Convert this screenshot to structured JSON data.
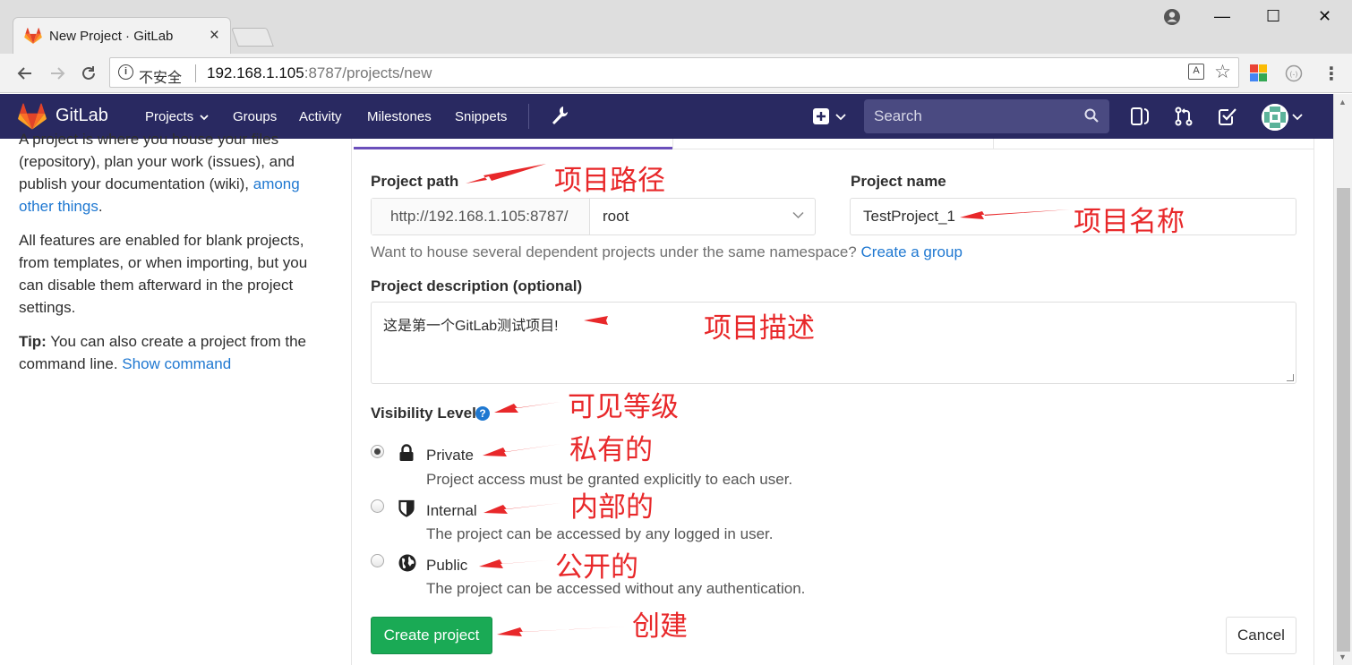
{
  "browser": {
    "tab_title": "New Project · GitLab",
    "tab_close": "×",
    "insecure_label": "不安全",
    "url_host": "192.168.1.105",
    "url_rest": ":8787/projects/new",
    "window_min": "—",
    "window_max": "☐",
    "window_close": "✕"
  },
  "header": {
    "brand": "GitLab",
    "nav": [
      "Projects",
      "Groups",
      "Activity",
      "Milestones",
      "Snippets"
    ],
    "search_placeholder": "Search",
    "colors": {
      "header_bg": "#292961",
      "search_bg": "#4a4a81",
      "accent": "#6b4fbb"
    }
  },
  "sidebar": {
    "intro_text": "A project is where you house your files (repository), plan your work (issues), and publish your documentation (wiki), ",
    "intro_link": "among other things",
    "intro_end": ".",
    "features_text": "All features are enabled for blank projects, from templates, or when importing, but you can disable them afterward in the project settings.",
    "tip_label": "Tip:",
    "tip_text": " You can also create a project from the command line. ",
    "tip_link": "Show command"
  },
  "form": {
    "path_label": "Project path",
    "path_prefix": "http://192.168.1.105:8787/",
    "namespace": "root",
    "name_label": "Project name",
    "name_value": "TestProject_1",
    "ns_help_text": "Want to house several dependent projects under the same namespace? ",
    "ns_help_link": "Create a group",
    "desc_label": "Project description (optional)",
    "desc_value": "这是第一个GitLab测试项目!",
    "visibility_label": "Visibility Level",
    "help_icon": "?",
    "visibility_options": [
      {
        "label": "Private",
        "desc": "Project access must be granted explicitly to each user.",
        "checked": true,
        "icon": "lock-icon"
      },
      {
        "label": "Internal",
        "desc": "The project can be accessed by any logged in user.",
        "checked": false,
        "icon": "shield-icon"
      },
      {
        "label": "Public",
        "desc": "The project can be accessed without any authentication.",
        "checked": false,
        "icon": "globe-icon"
      }
    ],
    "create_button": "Create project",
    "cancel_button": "Cancel",
    "colors": {
      "create_bg": "#1aaa55",
      "link": "#1f78d1"
    }
  },
  "annotations": {
    "path": "项目路径",
    "name": "项目名称",
    "desc": "项目描述",
    "visibility": "可见等级",
    "private": "私有的",
    "internal": "内部的",
    "public": "公开的",
    "create": "创建",
    "color": "#e8282a"
  }
}
